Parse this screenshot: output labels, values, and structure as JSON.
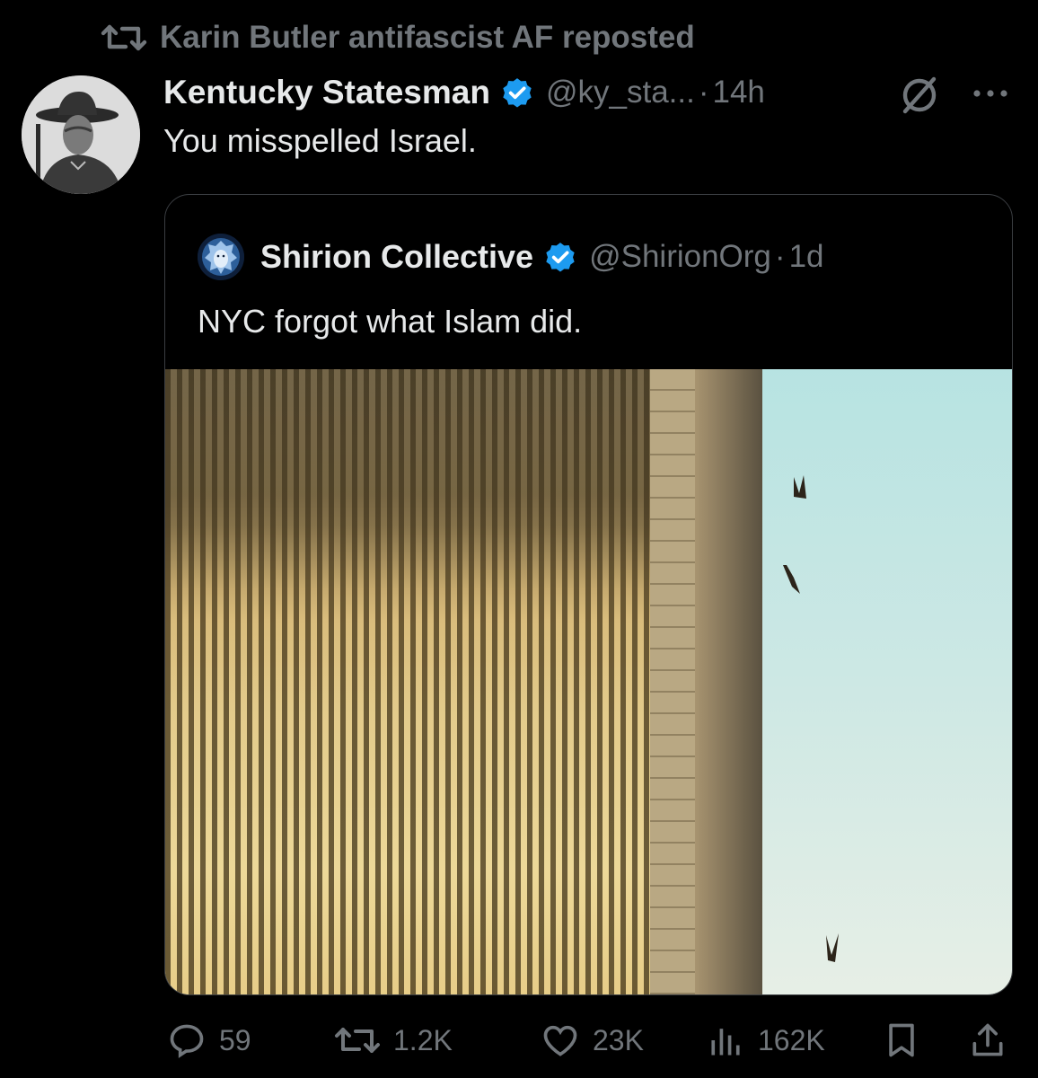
{
  "repost_banner": {
    "icon": "repost-icon",
    "text": "Karin Butler antifascist AF reposted"
  },
  "tweet": {
    "author_name": "Kentucky Statesman",
    "verified": true,
    "handle": "@ky_sta...",
    "separator": "·",
    "time": "14h",
    "text": "You misspelled Israel.",
    "icons": [
      "grok-icon",
      "more-icon"
    ]
  },
  "quoted": {
    "author_name": "Shirion Collective",
    "verified": true,
    "handle": "@ShirionOrg",
    "separator": "·",
    "time": "1d",
    "text": "NYC forgot what Islam did."
  },
  "actions": {
    "replies": "59",
    "reposts": "1.2K",
    "likes": "23K",
    "views": "162K"
  },
  "colors": {
    "background": "#000000",
    "primary_text": "#e7e9ea",
    "secondary_text": "#71767b",
    "verified_blue": "#1d9bf0",
    "card_border": "#3a3d41"
  }
}
